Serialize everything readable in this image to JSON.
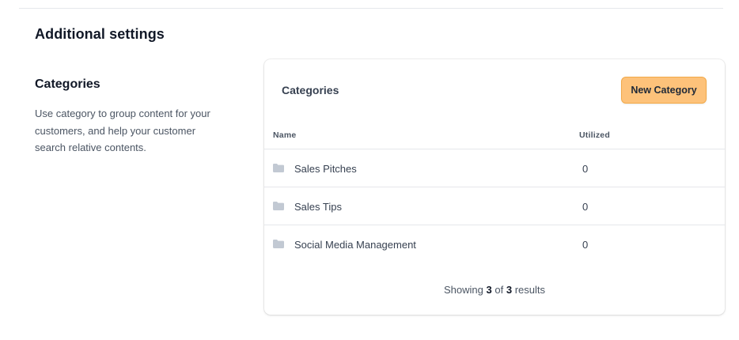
{
  "section": {
    "title": "Additional settings"
  },
  "categories_info": {
    "title": "Categories",
    "description": "Use category to group content for your customers, and help your customer search relative contents."
  },
  "card": {
    "title": "Categories",
    "new_button_label": "New Category",
    "columns": {
      "name": "Name",
      "utilized": "Utilized"
    },
    "rows": [
      {
        "name": "Sales Pitches",
        "utilized": "0",
        "icon": "folder-icon"
      },
      {
        "name": "Sales Tips",
        "utilized": "0",
        "icon": "folder-icon"
      },
      {
        "name": "Social Media Management",
        "utilized": "0",
        "icon": "folder-icon"
      }
    ],
    "footer": {
      "prefix": "Showing",
      "shown": "3",
      "middle": "of",
      "total": "3",
      "suffix": "results"
    }
  },
  "colors": {
    "button_bg": "#fdc27a",
    "button_border": "#f2a948",
    "folder_icon": "#c2c9d3"
  }
}
